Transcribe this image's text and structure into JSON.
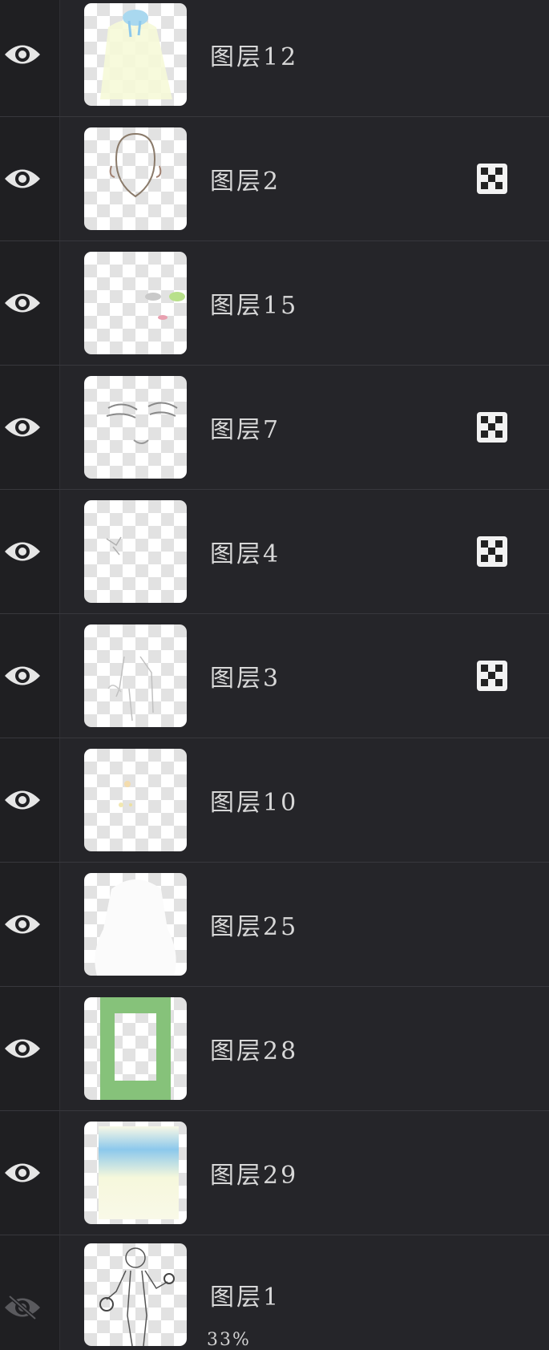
{
  "layers": [
    {
      "name": "图层12",
      "visible": true,
      "mask": false
    },
    {
      "name": "图层2",
      "visible": true,
      "mask": true
    },
    {
      "name": "图层15",
      "visible": true,
      "mask": false
    },
    {
      "name": "图层7",
      "visible": true,
      "mask": true
    },
    {
      "name": "图层4",
      "visible": true,
      "mask": true
    },
    {
      "name": "图层3",
      "visible": true,
      "mask": true
    },
    {
      "name": "图层10",
      "visible": true,
      "mask": false
    },
    {
      "name": "图层25",
      "visible": true,
      "mask": false
    },
    {
      "name": "图层28",
      "visible": true,
      "mask": false
    },
    {
      "name": "图层29",
      "visible": true,
      "mask": false
    },
    {
      "name": "图层1",
      "visible": false,
      "mask": false,
      "opacity": "33%"
    }
  ],
  "colors": {
    "background": "#252529",
    "text": "#d8d8d8",
    "eye_visible": "#e6e6e6",
    "eye_hidden": "#5a5a5e",
    "green_frame": "#86c27a",
    "sky_blue": "#8cc8ec"
  },
  "icons": {
    "visible": "eye-icon",
    "hidden": "eye-slash-icon",
    "mask": "checker-mask-icon"
  }
}
